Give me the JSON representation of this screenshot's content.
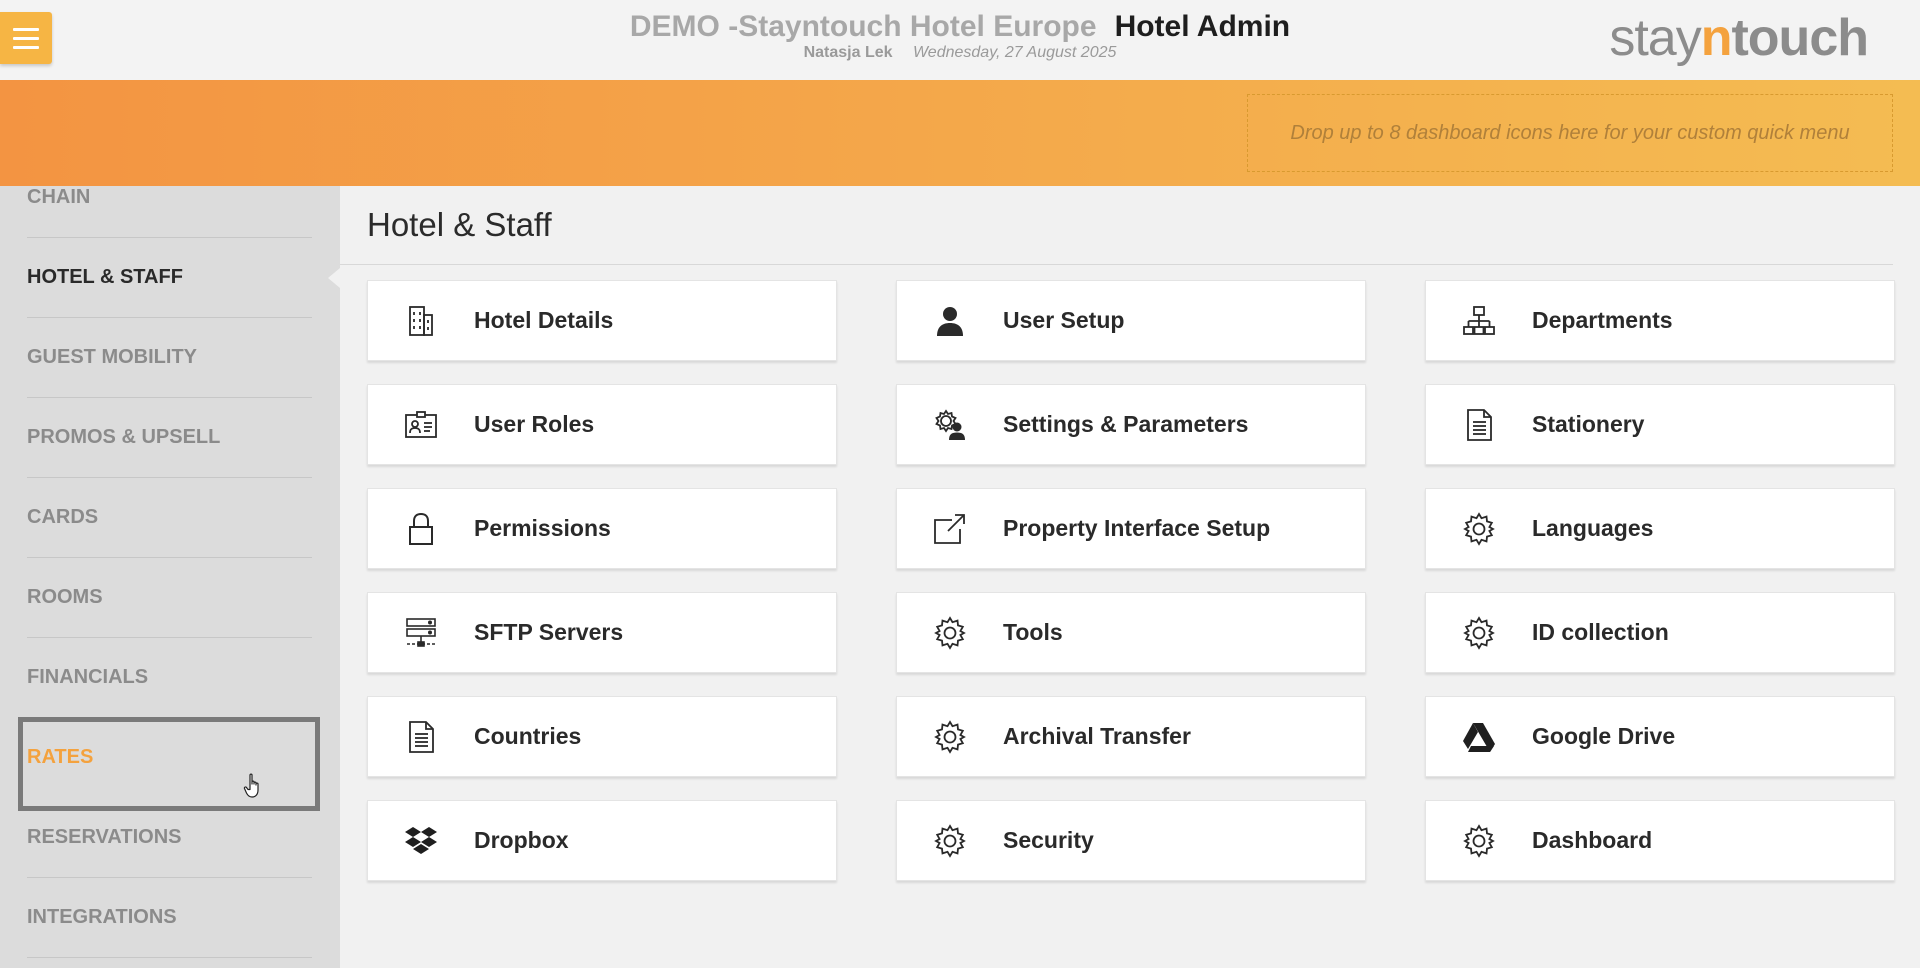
{
  "header": {
    "hotel_name": "DEMO -Stayntouch Hotel Europe",
    "app_title": "Hotel Admin",
    "user_name": "Natasja Lek",
    "date": "Wednesday, 27 August 2025",
    "logo": {
      "part1": "stay",
      "part2": "n",
      "part3": "touch"
    }
  },
  "banner": {
    "dropzone_text": "Drop up to 8 dashboard icons here for your custom quick menu"
  },
  "sidebar": {
    "items": [
      {
        "label": "CHAIN"
      },
      {
        "label": "HOTEL & STAFF"
      },
      {
        "label": "GUEST MOBILITY"
      },
      {
        "label": "PROMOS & UPSELL"
      },
      {
        "label": "CARDS"
      },
      {
        "label": "ROOMS"
      },
      {
        "label": "FINANCIALS"
      },
      {
        "label": "RATES"
      },
      {
        "label": "RESERVATIONS"
      },
      {
        "label": "INTEGRATIONS"
      }
    ],
    "active_item": "HOTEL & STAFF",
    "hovered_item": "RATES"
  },
  "main": {
    "title": "Hotel & Staff",
    "tiles": [
      {
        "label": "Hotel Details",
        "icon": "building-icon"
      },
      {
        "label": "User Setup",
        "icon": "user-icon"
      },
      {
        "label": "Departments",
        "icon": "org-chart-icon"
      },
      {
        "label": "User Roles",
        "icon": "id-card-icon"
      },
      {
        "label": "Settings & Parameters",
        "icon": "user-gear-icon"
      },
      {
        "label": "Stationery",
        "icon": "document-icon"
      },
      {
        "label": "Permissions",
        "icon": "lock-icon"
      },
      {
        "label": "Property Interface Setup",
        "icon": "external-link-icon"
      },
      {
        "label": "Languages",
        "icon": "gear-icon"
      },
      {
        "label": "SFTP Servers",
        "icon": "server-icon"
      },
      {
        "label": "Tools",
        "icon": "gear-icon"
      },
      {
        "label": "ID collection",
        "icon": "gear-icon"
      },
      {
        "label": "Countries",
        "icon": "document-icon"
      },
      {
        "label": "Archival Transfer",
        "icon": "gear-icon"
      },
      {
        "label": "Google Drive",
        "icon": "google-drive-icon"
      },
      {
        "label": "Dropbox",
        "icon": "dropbox-icon"
      },
      {
        "label": "Security",
        "icon": "gear-icon"
      },
      {
        "label": "Dashboard",
        "icon": "gear-icon"
      }
    ]
  },
  "colors": {
    "accent_orange": "#f4a23e",
    "menu_button": "#f6b544",
    "sidebar_bg": "#dcdcdc"
  }
}
